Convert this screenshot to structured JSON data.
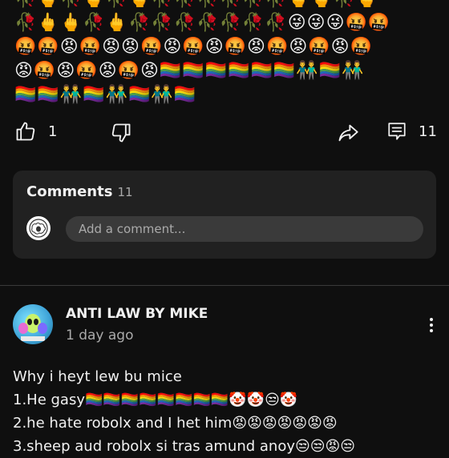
{
  "emoji_block": {
    "lines": [
      "🥀🖕🥀🖕🥀🖕🥀🥀🥀🥀🥀🥀🖕🖕🥀🖕",
      "🥀🖕🖕🥀🖕🥀🥀🥀🥀🥀🥀🥀😜😜😜🤬🤬",
      "🤬🤬😡🤬😡😡🤬😡🤬😡🤬😡🤬😡🤬😡🤬",
      "😡🤬😡🤬😡🤬😡🏳️‍🌈🏳️‍🌈🏳️‍🌈🏳️‍🌈🏳️‍🌈🏳️‍🌈👬🏳️‍🌈👬",
      "🏳️‍🌈🏳️‍🌈👬🏳️‍🌈👬🏳️‍🌈👬🏳️‍🌈"
    ]
  },
  "actions": {
    "like_count": "1",
    "comment_count": "11"
  },
  "comments_section": {
    "title": "Comments",
    "count": "11",
    "placeholder": "Add a comment..."
  },
  "comment": {
    "author": "ANTI LAW BY MIKE",
    "time": "1 day ago",
    "lines": [
      "Why i heyt lew bu mice",
      "1.He gasy🏳️‍🌈🏳️‍🌈🏳️‍🌈🏳️‍🌈🏳️‍🌈🏳️‍🌈🏳️‍🌈🏳️‍🌈🤡🤡😒🤡",
      "2.he hate robolx and I het him😡😡😡😡😡😡😡",
      "3.sheep aud robolx si tras amund anoy😒😒😡😒"
    ]
  },
  "colors": {
    "background": "#0f0f0f",
    "card": "#212121",
    "input": "#3a3a3a",
    "text": "#f1f1f1",
    "muted": "#aaaaaa"
  }
}
